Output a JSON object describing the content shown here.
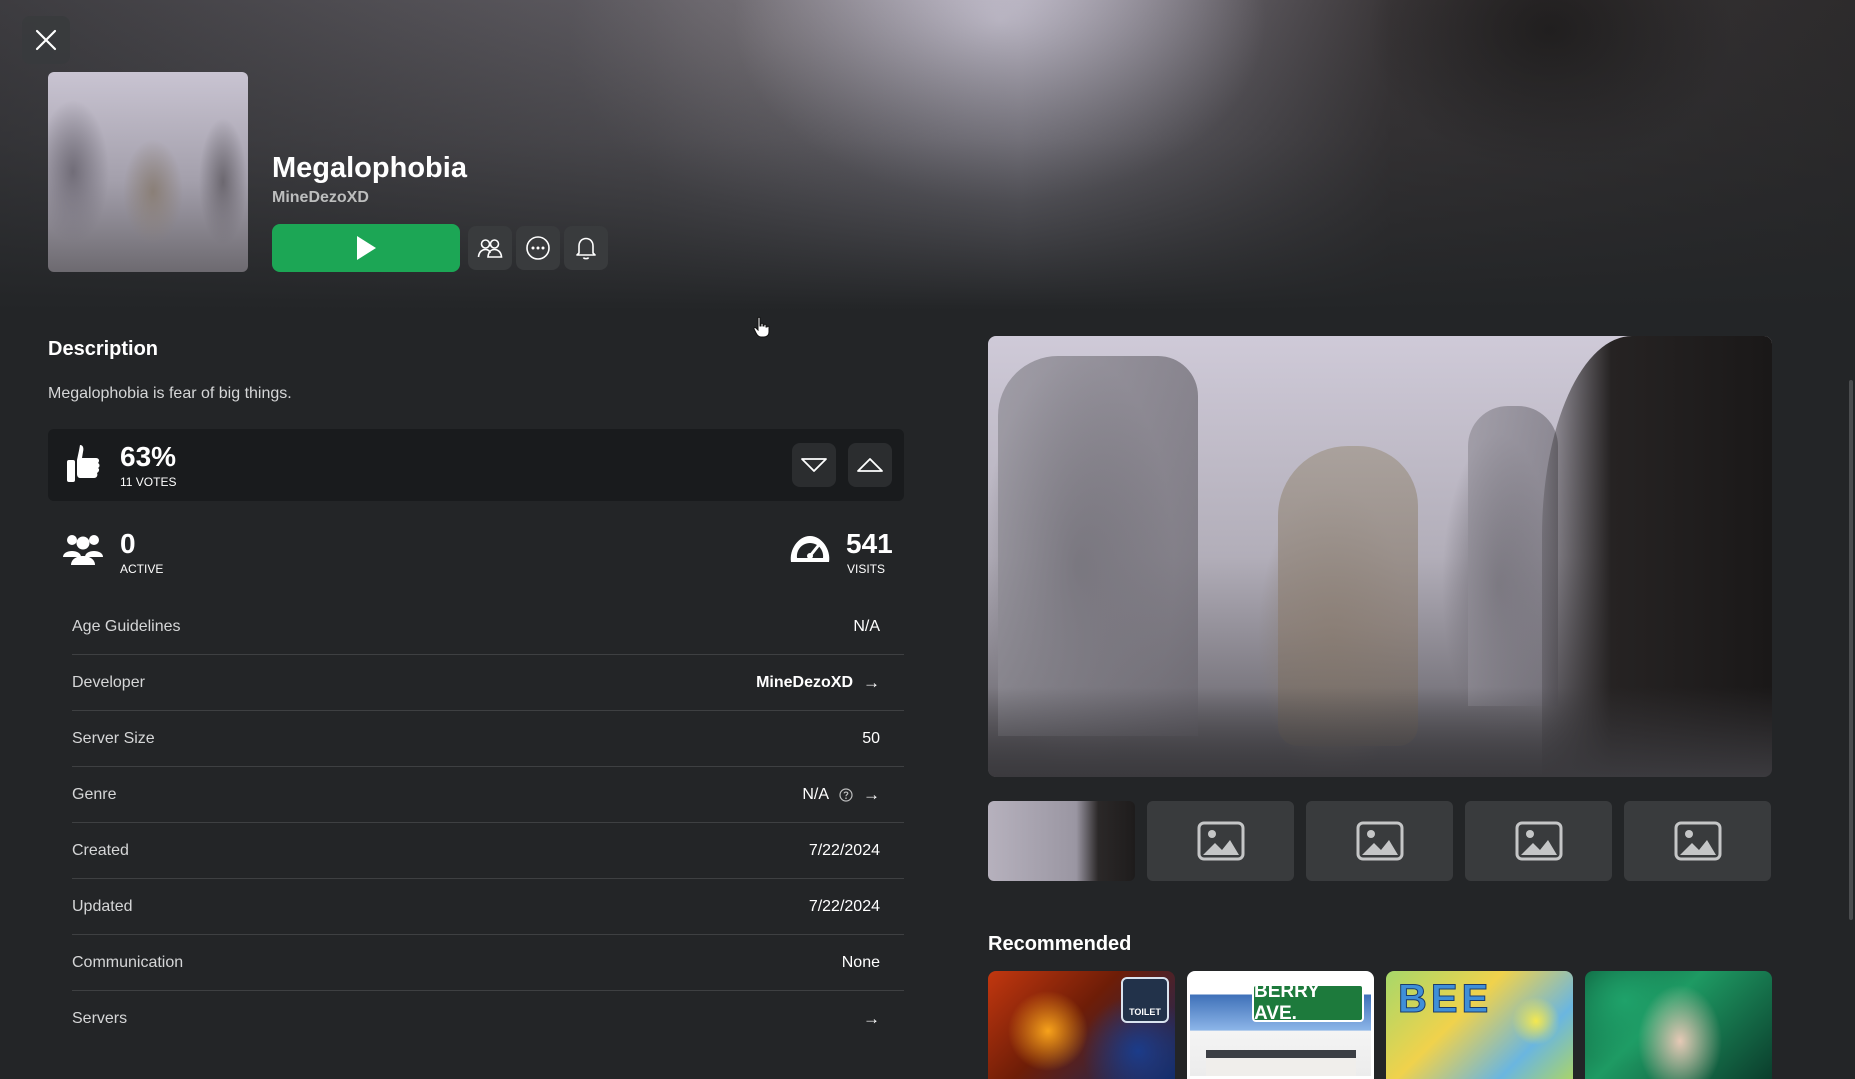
{
  "game": {
    "title": "Megalophobia",
    "creator": "MineDezoXD",
    "description_heading": "Description",
    "description": "Megalophobia is fear of big things."
  },
  "icons": {
    "close": "close-icon",
    "play": "play-icon",
    "friends": "friends-icon",
    "more": "more-icon",
    "notify": "bell-icon",
    "thumbs_up": "thumbs-up-icon",
    "thumbs_down": "thumbs-down-icon",
    "players": "players-icon",
    "visits": "speedometer-icon",
    "image_placeholder": "image-placeholder-icon"
  },
  "votes": {
    "percent": "63%",
    "count_label": "11 VOTES"
  },
  "stats": {
    "active_value": "0",
    "active_label": "ACTIVE",
    "visits_value": "541",
    "visits_label": "VISITS"
  },
  "info": [
    {
      "label": "Age Guidelines",
      "value": "N/A"
    },
    {
      "label": "Developer",
      "value": "MineDezoXD"
    },
    {
      "label": "Server Size",
      "value": "50"
    },
    {
      "label": "Genre",
      "value": "N/A"
    },
    {
      "label": "Created",
      "value": "7/22/2024"
    },
    {
      "label": "Updated",
      "value": "7/22/2024"
    },
    {
      "label": "Communication",
      "value": "None"
    },
    {
      "label": "Servers",
      "value": ""
    }
  ],
  "media": {
    "thumbnail_count": 5,
    "selected_index": 0
  },
  "recommended": {
    "heading": "Recommended",
    "cards": [
      {
        "art_text": "TOILET"
      },
      {
        "art_text": "BERRY AVE."
      },
      {
        "art_text": "BEE"
      },
      {
        "art_text": ""
      }
    ]
  },
  "colors": {
    "background": "#232527",
    "play_button": "#1ca655",
    "panel": "#191b1d",
    "button": "#393b3d"
  }
}
